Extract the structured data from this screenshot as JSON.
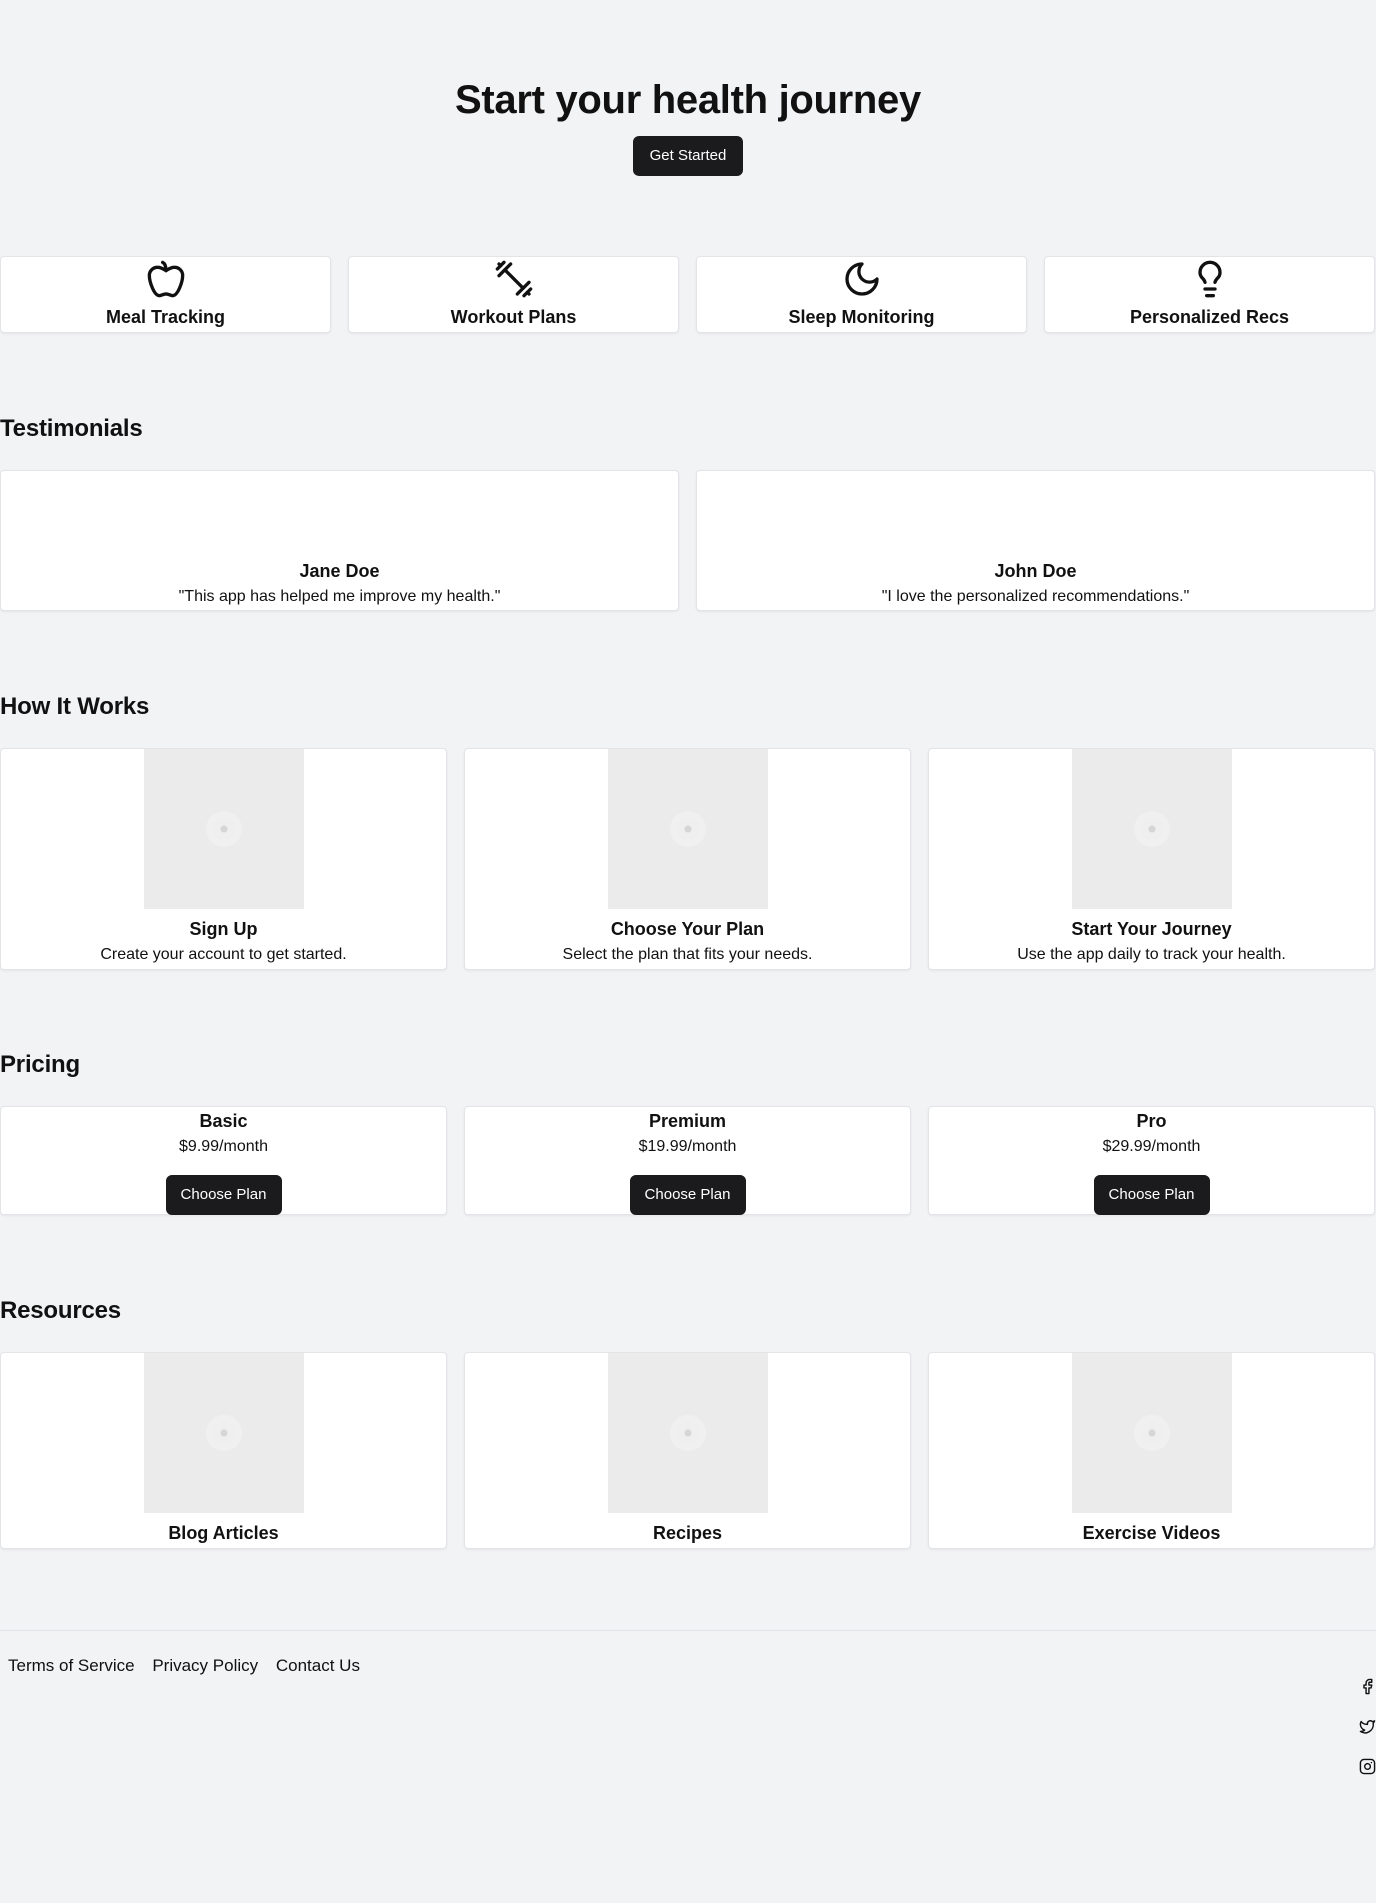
{
  "hero": {
    "title": "Start your health journey",
    "cta_label": "Get Started"
  },
  "features": [
    {
      "icon": "apple-icon",
      "label": "Meal Tracking"
    },
    {
      "icon": "dumbbell-icon",
      "label": "Workout Plans"
    },
    {
      "icon": "moon-icon",
      "label": "Sleep Monitoring"
    },
    {
      "icon": "lightbulb-icon",
      "label": "Personalized Recs"
    }
  ],
  "testimonials": {
    "title": "Testimonials",
    "items": [
      {
        "name": "Jane Doe",
        "quote": "\"This app has helped me improve my health.\""
      },
      {
        "name": "John Doe",
        "quote": "\"I love the personalized recommendations.\""
      }
    ]
  },
  "how_it_works": {
    "title": "How It Works",
    "steps": [
      {
        "title": "Sign Up",
        "description": "Create your account to get started."
      },
      {
        "title": "Choose Your Plan",
        "description": "Select the plan that fits your needs."
      },
      {
        "title": "Start Your Journey",
        "description": "Use the app daily to track your health."
      }
    ]
  },
  "pricing": {
    "title": "Pricing",
    "plans": [
      {
        "name": "Basic",
        "price": "$9.99/month",
        "button_label": "Choose Plan"
      },
      {
        "name": "Premium",
        "price": "$19.99/month",
        "button_label": "Choose Plan"
      },
      {
        "name": "Pro",
        "price": "$29.99/month",
        "button_label": "Choose Plan"
      }
    ]
  },
  "resources": {
    "title": "Resources",
    "items": [
      {
        "title": "Blog Articles"
      },
      {
        "title": "Recipes"
      },
      {
        "title": "Exercise Videos"
      }
    ]
  },
  "footer": {
    "links": [
      "Terms of Service",
      "Privacy Policy",
      "Contact Us"
    ],
    "social": [
      "facebook-icon",
      "twitter-icon",
      "instagram-icon"
    ]
  },
  "colors": {
    "background": "#f2f3f5",
    "card": "#ffffff",
    "button": "#1b1b1d",
    "placeholder": "#ebebeb"
  }
}
